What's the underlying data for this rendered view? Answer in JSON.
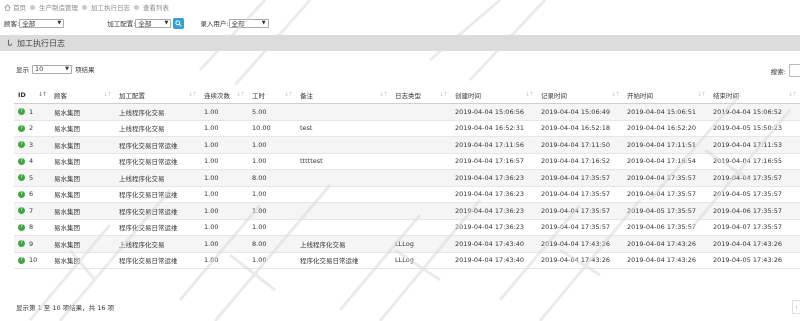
{
  "breadcrumb": [
    "首页",
    "生产制造管理",
    "加工执行日志",
    "查看列表"
  ],
  "filters": [
    {
      "label": "顾客:",
      "value": "全部"
    },
    {
      "label": "加工配置:",
      "value": "全部"
    },
    {
      "label": "录入用户:",
      "value": "全部"
    }
  ],
  "panel": {
    "title": "加工执行日志"
  },
  "length": {
    "prefix": "显示",
    "value": "10",
    "suffix": "项结果"
  },
  "search": {
    "label": "搜索:"
  },
  "table": {
    "columns": [
      "ID",
      "顾客",
      "加工配置",
      "连续次数",
      "工时",
      "备注",
      "日志类型",
      "创建时间",
      "记录时间",
      "开始时间",
      "结束时间"
    ],
    "rows": [
      [
        "1",
        "易水集团",
        "上线程序化交易",
        "1.00",
        "5.00",
        "",
        "",
        "2019-04-04 15:06:56",
        "2019-04-04 15:06:49",
        "2019-04-04 15:06:51",
        "2019-04-04 15:06:52"
      ],
      [
        "2",
        "易水集团",
        "上线程序化交易",
        "1.00",
        "10.00",
        "test",
        "",
        "2019-04-04 16:52:31",
        "2019-04-04 16:52:18",
        "2019-04-04 16:52:20",
        "2019-04-05 15:50:23"
      ],
      [
        "3",
        "易水集团",
        "程序化交易日常运维",
        "1.00",
        "1.00",
        "",
        "",
        "2019-04-04 17:11:56",
        "2019-04-04 17:11:50",
        "2019-04-04 17:11:51",
        "2019-04-04 17:11:53"
      ],
      [
        "4",
        "易水集团",
        "程序化交易日常运维",
        "1.00",
        "1.00",
        "tttttest",
        "",
        "2019-04-04 17:16:57",
        "2019-04-04 17:16:52",
        "2019-04-04 17:16:54",
        "2019-04-04 17:16:55"
      ],
      [
        "5",
        "易水集团",
        "上线程序化交易",
        "1.00",
        "8.00",
        "",
        "",
        "2019-04-04 17:36:23",
        "2019-04-04 17:35:57",
        "2019-04-04 17:35:57",
        "2019-04-04 17:35:57"
      ],
      [
        "6",
        "易水集团",
        "程序化交易日常运维",
        "1.00",
        "1.00",
        "",
        "",
        "2019-04-04 17:36:23",
        "2019-04-04 17:35:57",
        "2019-04-04 17:35:57",
        "2019-04-05 17:35:57"
      ],
      [
        "7",
        "易水集团",
        "程序化交易日常运维",
        "1.00",
        "1.00",
        "",
        "",
        "2019-04-04 17:36:23",
        "2019-04-04 17:35:57",
        "2019-04-05 17:35:57",
        "2019-04-06 17:35:57"
      ],
      [
        "8",
        "易水集团",
        "程序化交易日常运维",
        "1.00",
        "1.00",
        "",
        "",
        "2019-04-04 17:36:23",
        "2019-04-04 17:35:57",
        "2019-04-06 17:35:57",
        "2019-04-07 17:35:57"
      ],
      [
        "9",
        "易水集团",
        "上线程序化交易",
        "1.00",
        "8.00",
        "上线程序化交易",
        "LLLog",
        "2019-04-04 17:43:40",
        "2019-04-04 17:43:26",
        "2019-04-04 17:43:26",
        "2019-04-04 17:43:26"
      ],
      [
        "10",
        "易水集团",
        "程序化交易日常运维",
        "1.00",
        "1.00",
        "程序化交易日常运维",
        "LLLog",
        "2019-04-04 17:43:40",
        "2019-04-04 17:43:26",
        "2019-04-04 17:43:26",
        "2019-04-05 17:43:26"
      ]
    ]
  },
  "info": "显示第 1 至 10 项结果，共 16 项",
  "icons": {
    "home": "home-icon",
    "search": "search-icon",
    "tag": "tag-icon",
    "status": "status-icon",
    "pager": "prev-page-icon"
  },
  "colors": {
    "accent": "#33a1d6",
    "status": "#3aa93a",
    "header_bg": "#dcdcdc"
  }
}
